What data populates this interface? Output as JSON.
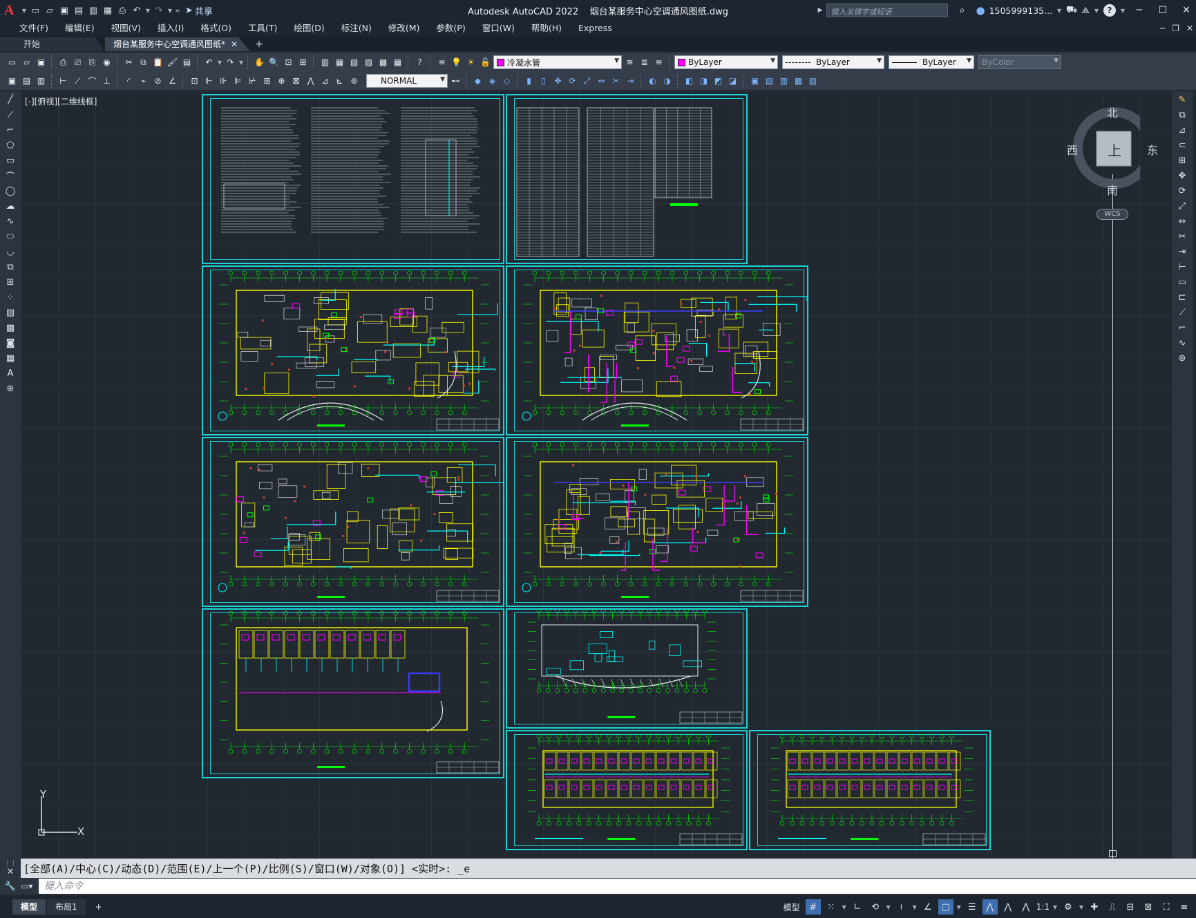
{
  "titlebar": {
    "app_name": "Autodesk AutoCAD 2022",
    "file_name": "烟台某服务中心空调通风图纸.dwg",
    "share_label": "共享",
    "search_placeholder": "键入关键字或短语",
    "user": "1505999135...",
    "help": "?"
  },
  "menu": [
    "文件(F)",
    "编辑(E)",
    "视图(V)",
    "插入(I)",
    "格式(O)",
    "工具(T)",
    "绘图(D)",
    "标注(N)",
    "修改(M)",
    "参数(P)",
    "窗口(W)",
    "帮助(H)",
    "Express"
  ],
  "tabs": {
    "start": "开始",
    "drawing": "烟台某服务中心空调通风图纸*"
  },
  "toolbar1": {
    "layer_name": "冷凝水管",
    "layer_color": "#ff00ff",
    "color": "ByLayer",
    "linetype": "ByLayer",
    "lineweight": "ByLayer",
    "plotstyle": "ByColor"
  },
  "toolbar2": {
    "dimstyle": "NORMAL"
  },
  "viewport": {
    "label": "[-][俯视][二维线框]"
  },
  "viewcube": {
    "north": "北",
    "south": "南",
    "east": "东",
    "west": "西",
    "face": "上",
    "wcs": "WCS"
  },
  "ucs": {
    "x": "X",
    "y": "Y"
  },
  "command": {
    "history": "[全部(A)/中心(C)/动态(D)/范围(E)/上一个(P)/比例(S)/窗口(W)/对象(O)] <实时>: _e",
    "placeholder": "键入命令"
  },
  "status": {
    "model_tab": "模型",
    "layout_tab": "布局1",
    "model_label": "模型",
    "scale": "1:1"
  },
  "colors": {
    "sheet_border": "#19d3d8",
    "wall": "#ffff00",
    "pipe": "#00ffff",
    "duct": "#00ff00",
    "magenta": "#ff00ff",
    "red": "#ff3030",
    "blue": "#4040ff"
  }
}
